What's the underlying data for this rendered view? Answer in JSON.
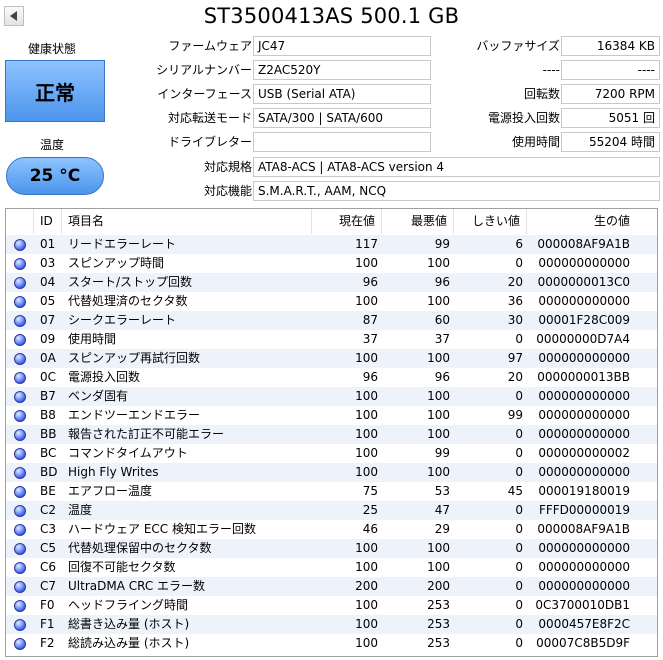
{
  "header": {
    "title": "ST3500413AS 500.1 GB"
  },
  "health": {
    "label": "健康状態",
    "status": "正常",
    "temp_label": "温度",
    "temp_value": "25 °C",
    "status_color": "#5aa0f0"
  },
  "info": {
    "firmware_label": "ファームウェア",
    "firmware_value": "JC47",
    "serial_label": "シリアルナンバー",
    "serial_value": "Z2AC520Y",
    "interface_label": "インターフェース",
    "interface_value": "USB (Serial ATA)",
    "transfer_label": "対応転送モード",
    "transfer_value": "SATA/300 | SATA/600",
    "drive_letter_label": "ドライブレター",
    "drive_letter_value": "",
    "standard_label": "対応規格",
    "standard_value": "ATA8-ACS | ATA8-ACS version 4",
    "features_label": "対応機能",
    "features_value": "S.M.A.R.T., AAM, NCQ",
    "buffer_label": "バッファサイズ",
    "buffer_value": "16384 KB",
    "blank1_label": "----",
    "blank1_value": "----",
    "rotation_label": "回転数",
    "rotation_value": "7200 RPM",
    "power_count_label": "電源投入回数",
    "power_count_value": "5051 回",
    "power_hours_label": "使用時間",
    "power_hours_value": "55204 時間"
  },
  "table": {
    "headers": {
      "id": "ID",
      "name": "項目名",
      "current": "現在値",
      "worst": "最悪値",
      "threshold": "しきい値",
      "raw": "生の値"
    },
    "rows": [
      {
        "id": "01",
        "name": "リードエラーレート",
        "current": "117",
        "worst": "99",
        "threshold": "6",
        "raw": "000008AF9A1B"
      },
      {
        "id": "03",
        "name": "スピンアップ時間",
        "current": "100",
        "worst": "100",
        "threshold": "0",
        "raw": "000000000000"
      },
      {
        "id": "04",
        "name": "スタート/ストップ回数",
        "current": "96",
        "worst": "96",
        "threshold": "20",
        "raw": "0000000013C0"
      },
      {
        "id": "05",
        "name": "代替処理済のセクタ数",
        "current": "100",
        "worst": "100",
        "threshold": "36",
        "raw": "000000000000"
      },
      {
        "id": "07",
        "name": "シークエラーレート",
        "current": "87",
        "worst": "60",
        "threshold": "30",
        "raw": "00001F28C009"
      },
      {
        "id": "09",
        "name": "使用時間",
        "current": "37",
        "worst": "37",
        "threshold": "0",
        "raw": "00000000D7A4"
      },
      {
        "id": "0A",
        "name": "スピンアップ再試行回数",
        "current": "100",
        "worst": "100",
        "threshold": "97",
        "raw": "000000000000"
      },
      {
        "id": "0C",
        "name": "電源投入回数",
        "current": "96",
        "worst": "96",
        "threshold": "20",
        "raw": "0000000013BB"
      },
      {
        "id": "B7",
        "name": "ベンダ固有",
        "current": "100",
        "worst": "100",
        "threshold": "0",
        "raw": "000000000000"
      },
      {
        "id": "B8",
        "name": "エンドツーエンドエラー",
        "current": "100",
        "worst": "100",
        "threshold": "99",
        "raw": "000000000000"
      },
      {
        "id": "BB",
        "name": "報告された訂正不可能エラー",
        "current": "100",
        "worst": "100",
        "threshold": "0",
        "raw": "000000000000"
      },
      {
        "id": "BC",
        "name": "コマンドタイムアウト",
        "current": "100",
        "worst": "99",
        "threshold": "0",
        "raw": "000000000002"
      },
      {
        "id": "BD",
        "name": "High Fly Writes",
        "current": "100",
        "worst": "100",
        "threshold": "0",
        "raw": "000000000000"
      },
      {
        "id": "BE",
        "name": "エアフロー温度",
        "current": "75",
        "worst": "53",
        "threshold": "45",
        "raw": "000019180019"
      },
      {
        "id": "C2",
        "name": "温度",
        "current": "25",
        "worst": "47",
        "threshold": "0",
        "raw": "FFFD00000019"
      },
      {
        "id": "C3",
        "name": "ハードウェア ECC 検知エラー回数",
        "current": "46",
        "worst": "29",
        "threshold": "0",
        "raw": "000008AF9A1B"
      },
      {
        "id": "C5",
        "name": "代替処理保留中のセクタ数",
        "current": "100",
        "worst": "100",
        "threshold": "0",
        "raw": "000000000000"
      },
      {
        "id": "C6",
        "name": "回復不可能セクタ数",
        "current": "100",
        "worst": "100",
        "threshold": "0",
        "raw": "000000000000"
      },
      {
        "id": "C7",
        "name": "UltraDMA CRC エラー数",
        "current": "200",
        "worst": "200",
        "threshold": "0",
        "raw": "000000000000"
      },
      {
        "id": "F0",
        "name": "ヘッドフライング時間",
        "current": "100",
        "worst": "253",
        "threshold": "0",
        "raw": "0C3700010DB1"
      },
      {
        "id": "F1",
        "name": "総書き込み量 (ホスト)",
        "current": "100",
        "worst": "253",
        "threshold": "0",
        "raw": "0000457E8F2C"
      },
      {
        "id": "F2",
        "name": "総読み込み量 (ホスト)",
        "current": "100",
        "worst": "253",
        "threshold": "0",
        "raw": "00007C8B5D9F"
      }
    ]
  }
}
